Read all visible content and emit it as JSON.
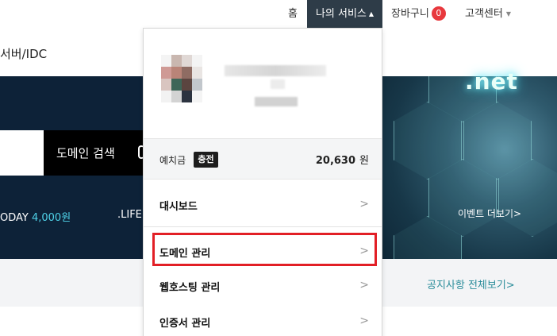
{
  "topnav": {
    "home": "홈",
    "my_service": "나의 서비스",
    "my_service_caret": "▲",
    "cart": "장바구니",
    "cart_count": "0",
    "customer_center": "고객센터",
    "cs_caret": "▼"
  },
  "page": {
    "subtitle": "서버/IDC"
  },
  "banner": {
    "search_button": "도메인 검색",
    "price_today_prefix": "ODAY",
    "price_today_value": "4,000원",
    "price_life": ".LIFE",
    "net_text": ".net",
    "event_more": "이벤트 더보기>"
  },
  "notice": {
    "link": "공지사항 전체보기>"
  },
  "dropdown": {
    "balance_label": "예치금",
    "charge_button": "충전",
    "balance_value": "20,630",
    "balance_unit": "원",
    "items": [
      {
        "label": "대시보드",
        "chevron": ">"
      },
      {
        "label": "도메인 관리",
        "chevron": ">"
      },
      {
        "label": "웹호스팅 관리",
        "chevron": ">"
      },
      {
        "label": "인증서 관리",
        "chevron": ">"
      }
    ]
  },
  "colors": {
    "nav_active": "#2e3c48",
    "badge": "#e8383d",
    "banner_bg": "#0d2238",
    "highlight": "#e21f26",
    "notice_link": "#2a8c9a"
  }
}
